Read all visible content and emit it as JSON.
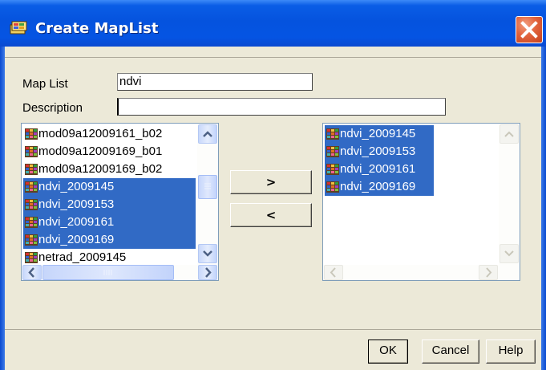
{
  "window": {
    "title": "Create MapList",
    "title_icon": "maplist-icon",
    "close_icon": "close-icon"
  },
  "form": {
    "map_list_label": "Map List",
    "map_list_value": "ndvi",
    "description_label": "Description",
    "description_value": ""
  },
  "available_list": {
    "items": [
      {
        "label": "mod09a12009161_b02",
        "selected": false
      },
      {
        "label": "mod09a12009169_b01",
        "selected": false
      },
      {
        "label": "mod09a12009169_b02",
        "selected": false
      },
      {
        "label": "ndvi_2009145",
        "selected": true
      },
      {
        "label": "ndvi_2009153",
        "selected": true
      },
      {
        "label": "ndvi_2009161",
        "selected": true
      },
      {
        "label": "ndvi_2009169",
        "selected": true
      },
      {
        "label": "netrad_2009145",
        "selected": false
      }
    ]
  },
  "selected_list": {
    "items": [
      {
        "label": "ndvi_2009145",
        "selected": true
      },
      {
        "label": "ndvi_2009153",
        "selected": true
      },
      {
        "label": "ndvi_2009161",
        "selected": true
      },
      {
        "label": "ndvi_2009169",
        "selected": true
      }
    ]
  },
  "transfer": {
    "add_label": ">",
    "remove_label": "<"
  },
  "buttons": {
    "ok": "OK",
    "cancel": "Cancel",
    "help": "Help"
  },
  "colors": {
    "title_bar": "#0553de",
    "selection": "#316ac5",
    "face": "#ece9d8",
    "close_button": "#e2633c"
  }
}
